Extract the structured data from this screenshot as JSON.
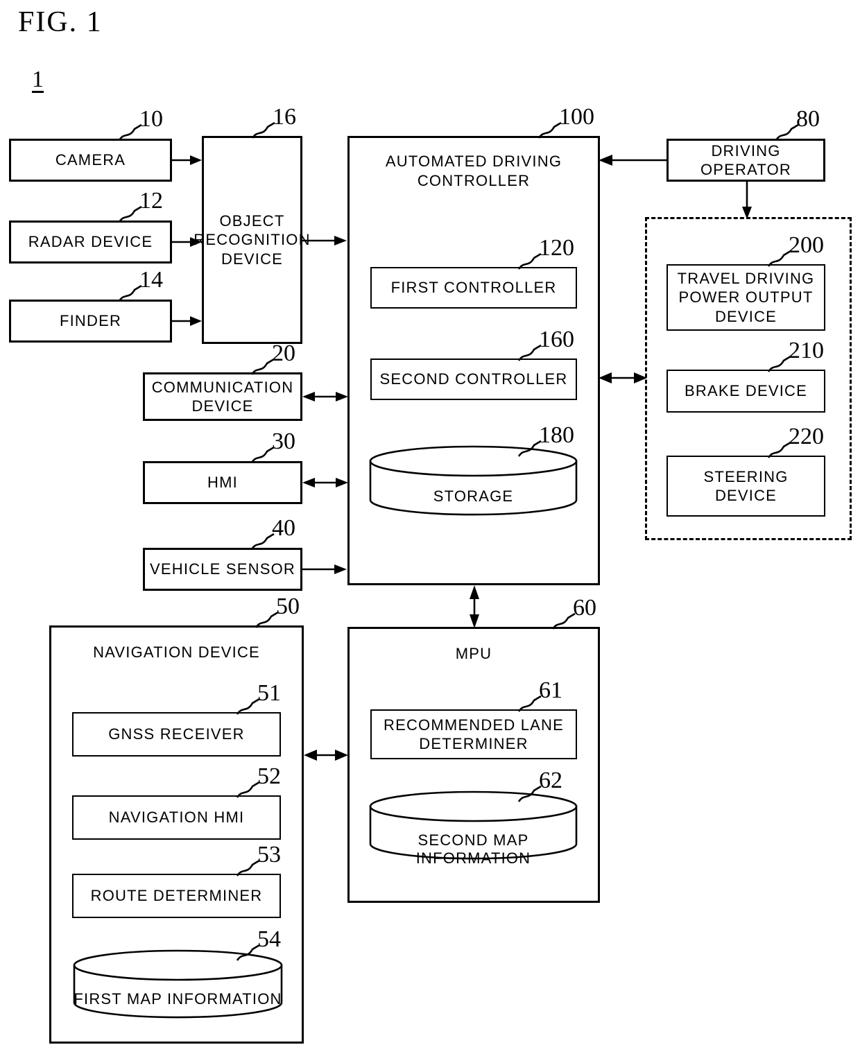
{
  "figure": {
    "title": "FIG. 1",
    "system_ref": "1"
  },
  "blocks": {
    "camera": {
      "label": "CAMERA",
      "ref": "10"
    },
    "radar": {
      "label": "RADAR DEVICE",
      "ref": "12"
    },
    "finder": {
      "label": "FINDER",
      "ref": "14"
    },
    "object_recognition": {
      "label": "OBJECT\nRECOGNITION\nDEVICE",
      "ref": "16"
    },
    "communication": {
      "label": "COMMUNICATION\nDEVICE",
      "ref": "20"
    },
    "hmi": {
      "label": "HMI",
      "ref": "30"
    },
    "vehicle_sensor": {
      "label": "VEHICLE SENSOR",
      "ref": "40"
    },
    "automated_driving": {
      "label": "AUTOMATED DRIVING\nCONTROLLER",
      "ref": "100"
    },
    "first_controller": {
      "label": "FIRST CONTROLLER",
      "ref": "120"
    },
    "second_controller": {
      "label": "SECOND CONTROLLER",
      "ref": "160"
    },
    "storage": {
      "label": "STORAGE",
      "ref": "180"
    },
    "driving_operator": {
      "label": "DRIVING OPERATOR",
      "ref": "80"
    },
    "travel_power": {
      "label": "TRAVEL DRIVING\nPOWER OUTPUT\nDEVICE",
      "ref": "200"
    },
    "brake": {
      "label": "BRAKE DEVICE",
      "ref": "210"
    },
    "steering": {
      "label": "STEERING\nDEVICE",
      "ref": "220"
    },
    "navigation": {
      "label": "NAVIGATION DEVICE",
      "ref": "50"
    },
    "gnss": {
      "label": "GNSS RECEIVER",
      "ref": "51"
    },
    "nav_hmi": {
      "label": "NAVIGATION HMI",
      "ref": "52"
    },
    "route_determiner": {
      "label": "ROUTE DETERMINER",
      "ref": "53"
    },
    "first_map": {
      "label": "FIRST MAP INFORMATION",
      "ref": "54"
    },
    "mpu": {
      "label": "MPU",
      "ref": "60"
    },
    "recommended_lane": {
      "label": "RECOMMENDED LANE\nDETERMINER",
      "ref": "61"
    },
    "second_map": {
      "label": "SECOND MAP INFORMATION",
      "ref": "62"
    }
  },
  "style": {
    "line_color": "#000000",
    "background": "#ffffff"
  }
}
